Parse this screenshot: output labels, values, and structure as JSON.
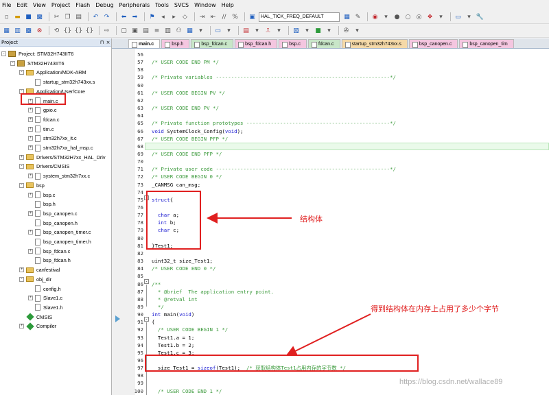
{
  "menu": [
    "File",
    "Edit",
    "View",
    "Project",
    "Flash",
    "Debug",
    "Peripherals",
    "Tools",
    "SVCS",
    "Window",
    "Help"
  ],
  "toolbar": {
    "define_combo": "HAL_TICK_FREQ_DEFAULT"
  },
  "project": {
    "header": "Project",
    "tree": [
      {
        "label": "Project: STM32H743IIT6",
        "level": 0,
        "kind": "root",
        "exp": "-"
      },
      {
        "label": "STM32H743IIT6",
        "level": 1,
        "kind": "target",
        "exp": "-"
      },
      {
        "label": "Application/MDK-ARM",
        "level": 2,
        "kind": "folder",
        "exp": "-"
      },
      {
        "label": "startup_stm32h743xx.s",
        "level": 3,
        "kind": "file",
        "exp": ""
      },
      {
        "label": "Application/User/Core",
        "level": 2,
        "kind": "folder",
        "exp": "-"
      },
      {
        "label": "main.c",
        "level": 3,
        "kind": "file",
        "exp": "+"
      },
      {
        "label": "gpio.c",
        "level": 3,
        "kind": "file",
        "exp": "+"
      },
      {
        "label": "fdcan.c",
        "level": 3,
        "kind": "file",
        "exp": "+"
      },
      {
        "label": "tim.c",
        "level": 3,
        "kind": "file",
        "exp": "+"
      },
      {
        "label": "stm32h7xx_it.c",
        "level": 3,
        "kind": "file",
        "exp": "+"
      },
      {
        "label": "stm32h7xx_hal_msp.c",
        "level": 3,
        "kind": "file",
        "exp": "+"
      },
      {
        "label": "Drivers/STM32H7xx_HAL_Driv",
        "level": 2,
        "kind": "folder",
        "exp": "+"
      },
      {
        "label": "Drivers/CMSIS",
        "level": 2,
        "kind": "folder",
        "exp": "-"
      },
      {
        "label": "system_stm32h7xx.c",
        "level": 3,
        "kind": "file",
        "exp": "+"
      },
      {
        "label": "bsp",
        "level": 2,
        "kind": "folder",
        "exp": "-"
      },
      {
        "label": "bsp.c",
        "level": 3,
        "kind": "file",
        "exp": "+"
      },
      {
        "label": "bsp.h",
        "level": 3,
        "kind": "file",
        "exp": ""
      },
      {
        "label": "bsp_canopen.c",
        "level": 3,
        "kind": "file",
        "exp": "+"
      },
      {
        "label": "bsp_canopen.h",
        "level": 3,
        "kind": "file",
        "exp": ""
      },
      {
        "label": "bsp_canopen_timer.c",
        "level": 3,
        "kind": "file",
        "exp": "+"
      },
      {
        "label": "bsp_canopen_timer.h",
        "level": 3,
        "kind": "file",
        "exp": ""
      },
      {
        "label": "bsp_fdcan.c",
        "level": 3,
        "kind": "file",
        "exp": "+"
      },
      {
        "label": "bsp_fdcan.h",
        "level": 3,
        "kind": "file",
        "exp": ""
      },
      {
        "label": "canfestival",
        "level": 2,
        "kind": "folder",
        "exp": "+"
      },
      {
        "label": "obj_dir",
        "level": 2,
        "kind": "folder",
        "exp": "-"
      },
      {
        "label": "config.h",
        "level": 3,
        "kind": "file",
        "exp": ""
      },
      {
        "label": "Slave1.c",
        "level": 3,
        "kind": "file",
        "exp": "+"
      },
      {
        "label": "Slave1.h",
        "level": 3,
        "kind": "file",
        "exp": ""
      },
      {
        "label": "CMSIS",
        "level": 2,
        "kind": "diamond",
        "exp": ""
      },
      {
        "label": "Compiler",
        "level": 2,
        "kind": "diamond",
        "exp": "+"
      }
    ]
  },
  "tabs": [
    "main.c",
    "bsp.h",
    "bsp_fdcan.c",
    "bsp_fdcan.h",
    "bsp.c",
    "fdcan.c",
    "startup_stm32h743xx.s",
    "bsp_canopen.c",
    "bsp_canopen_tim"
  ],
  "tab_colors": [
    "#f5f5f5",
    "#f4c6e0",
    "#c8e6c8",
    "#f4c6e0",
    "#f4c6e0",
    "#c8e6c8",
    "#f5d9a8",
    "#f4c6e0",
    "#f4c6e0"
  ],
  "code": [
    {
      "n": "56",
      "t": ""
    },
    {
      "n": "57",
      "t": "/* USER CODE END PM */",
      "c": "cm"
    },
    {
      "n": "58",
      "t": ""
    },
    {
      "n": "59",
      "t": "/* Private variables ---------------------------------------------------------*/",
      "c": "cm"
    },
    {
      "n": "60",
      "t": ""
    },
    {
      "n": "61",
      "t": "/* USER CODE BEGIN PV */",
      "c": "cm"
    },
    {
      "n": "62",
      "t": ""
    },
    {
      "n": "63",
      "t": "/* USER CODE END PV */",
      "c": "cm"
    },
    {
      "n": "64",
      "t": ""
    },
    {
      "n": "65",
      "t": "/* Private function prototypes -----------------------------------------------*/",
      "c": "cm"
    },
    {
      "n": "66",
      "t": "void SystemClock_Config(void);"
    },
    {
      "n": "67",
      "t": "/* USER CODE BEGIN PFP */",
      "c": "cm"
    },
    {
      "n": "68",
      "t": ""
    },
    {
      "n": "69",
      "t": "/* USER CODE END PFP */",
      "c": "cm"
    },
    {
      "n": "70",
      "t": ""
    },
    {
      "n": "71",
      "t": "/* Private user code ---------------------------------------------------------*/",
      "c": "cm"
    },
    {
      "n": "72",
      "t": "/* USER CODE BEGIN 0 */",
      "c": "cm"
    },
    {
      "n": "73",
      "t": "_CANMSG can_msg;"
    },
    {
      "n": "74",
      "t": ""
    },
    {
      "n": "75",
      "t": "struct{"
    },
    {
      "n": "76",
      "t": ""
    },
    {
      "n": "77",
      "t": "  char a;"
    },
    {
      "n": "78",
      "t": "  int b;"
    },
    {
      "n": "79",
      "t": "  char c;"
    },
    {
      "n": "80",
      "t": ""
    },
    {
      "n": "81",
      "t": "}Test1;"
    },
    {
      "n": "82",
      "t": ""
    },
    {
      "n": "83",
      "t": "uint32_t size_Test1;"
    },
    {
      "n": "84",
      "t": "/* USER CODE END 0 */",
      "c": "cm"
    },
    {
      "n": "85",
      "t": ""
    },
    {
      "n": "86",
      "t": "/**",
      "c": "cm"
    },
    {
      "n": "87",
      "t": "  * @brief  The application entry point.",
      "c": "cm"
    },
    {
      "n": "88",
      "t": "  * @retval int",
      "c": "cm"
    },
    {
      "n": "89",
      "t": "  */",
      "c": "cm"
    },
    {
      "n": "90",
      "t": "int main(void)"
    },
    {
      "n": "91",
      "t": "{"
    },
    {
      "n": "92",
      "t": "  /* USER CODE BEGIN 1 */",
      "c": "cm"
    },
    {
      "n": "93",
      "t": "  Test1.a = 1;"
    },
    {
      "n": "94",
      "t": "  Test1.b = 2;"
    },
    {
      "n": "95",
      "t": "  Test1.c = 3;"
    },
    {
      "n": "96",
      "t": ""
    },
    {
      "n": "97",
      "t": "  size_Test1 = sizeof(Test1);  /* 获取结构体Test1占用内存的字节数 */"
    },
    {
      "n": "98",
      "t": ""
    },
    {
      "n": "99",
      "t": ""
    },
    {
      "n": "100",
      "t": "  /* USER CODE END 1 */",
      "c": "cm"
    }
  ],
  "annotations": {
    "struct_label": "结构体",
    "sizeof_label": "得到结构体在内存上占用了多少个字节"
  },
  "watermark": "https://blog.csdn.net/wallace89",
  "colors": {
    "annotation": "#e02020",
    "comment": "#3c9a3c",
    "keyword": "#1a1ad0"
  }
}
